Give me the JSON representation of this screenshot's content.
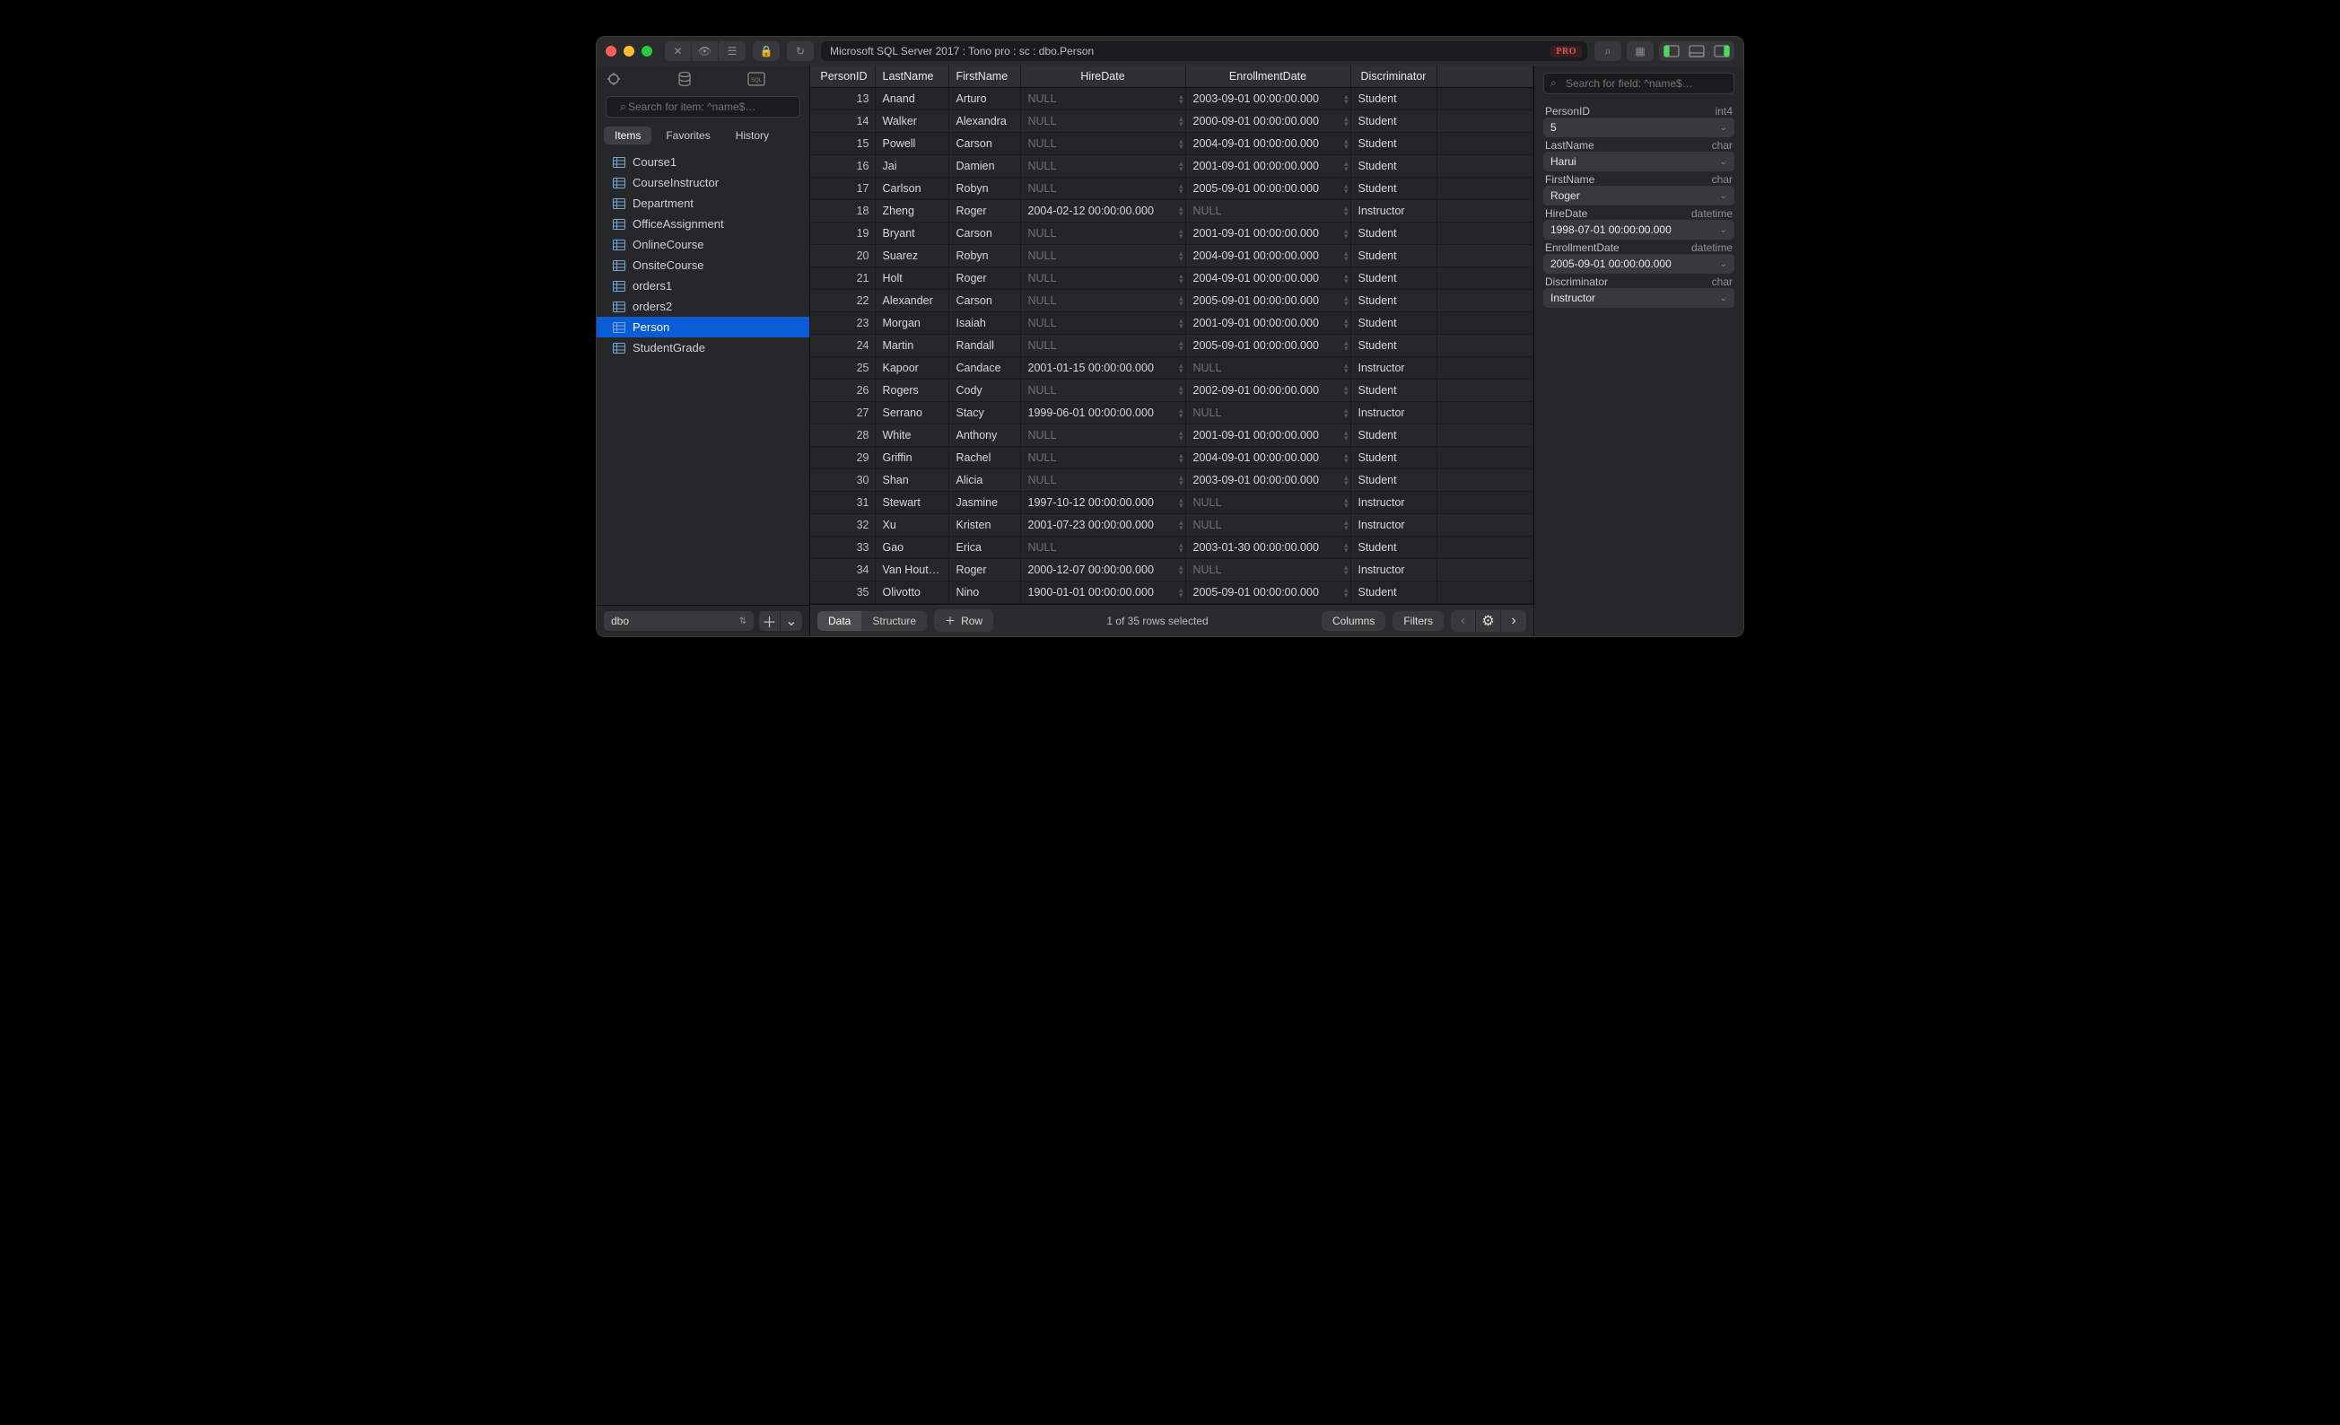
{
  "titlebar": {
    "breadcrumb": "Microsoft SQL Server 2017 : Tono pro : sc : dbo.Person",
    "pro_badge": "PRO"
  },
  "sidebar": {
    "search_placeholder": "Search for item: ^name$…",
    "tabs": [
      "Items",
      "Favorites",
      "History"
    ],
    "active_tab": 0,
    "items": [
      "Course1",
      "CourseInstructor",
      "Department",
      "OfficeAssignment",
      "OnlineCourse",
      "OnsiteCourse",
      "orders1",
      "orders2",
      "Person",
      "StudentGrade"
    ],
    "active_item": 8,
    "schema": "dbo"
  },
  "table": {
    "columns": [
      "PersonID",
      "LastName",
      "FirstName",
      "HireDate",
      "EnrollmentDate",
      "Discriminator"
    ],
    "rows": [
      {
        "id": "13",
        "last": "Anand",
        "first": "Arturo",
        "hire": null,
        "enroll": "2003-09-01 00:00:00.000",
        "disc": "Student"
      },
      {
        "id": "14",
        "last": "Walker",
        "first": "Alexandra",
        "hire": null,
        "enroll": "2000-09-01 00:00:00.000",
        "disc": "Student"
      },
      {
        "id": "15",
        "last": "Powell",
        "first": "Carson",
        "hire": null,
        "enroll": "2004-09-01 00:00:00.000",
        "disc": "Student"
      },
      {
        "id": "16",
        "last": "Jai",
        "first": "Damien",
        "hire": null,
        "enroll": "2001-09-01 00:00:00.000",
        "disc": "Student"
      },
      {
        "id": "17",
        "last": "Carlson",
        "first": "Robyn",
        "hire": null,
        "enroll": "2005-09-01 00:00:00.000",
        "disc": "Student"
      },
      {
        "id": "18",
        "last": "Zheng",
        "first": "Roger",
        "hire": "2004-02-12 00:00:00.000",
        "enroll": null,
        "disc": "Instructor"
      },
      {
        "id": "19",
        "last": "Bryant",
        "first": "Carson",
        "hire": null,
        "enroll": "2001-09-01 00:00:00.000",
        "disc": "Student"
      },
      {
        "id": "20",
        "last": "Suarez",
        "first": "Robyn",
        "hire": null,
        "enroll": "2004-09-01 00:00:00.000",
        "disc": "Student"
      },
      {
        "id": "21",
        "last": "Holt",
        "first": "Roger",
        "hire": null,
        "enroll": "2004-09-01 00:00:00.000",
        "disc": "Student"
      },
      {
        "id": "22",
        "last": "Alexander",
        "first": "Carson",
        "hire": null,
        "enroll": "2005-09-01 00:00:00.000",
        "disc": "Student"
      },
      {
        "id": "23",
        "last": "Morgan",
        "first": "Isaiah",
        "hire": null,
        "enroll": "2001-09-01 00:00:00.000",
        "disc": "Student"
      },
      {
        "id": "24",
        "last": "Martin",
        "first": "Randall",
        "hire": null,
        "enroll": "2005-09-01 00:00:00.000",
        "disc": "Student"
      },
      {
        "id": "25",
        "last": "Kapoor",
        "first": "Candace",
        "hire": "2001-01-15 00:00:00.000",
        "enroll": null,
        "disc": "Instructor"
      },
      {
        "id": "26",
        "last": "Rogers",
        "first": "Cody",
        "hire": null,
        "enroll": "2002-09-01 00:00:00.000",
        "disc": "Student"
      },
      {
        "id": "27",
        "last": "Serrano",
        "first": "Stacy",
        "hire": "1999-06-01 00:00:00.000",
        "enroll": null,
        "disc": "Instructor"
      },
      {
        "id": "28",
        "last": "White",
        "first": "Anthony",
        "hire": null,
        "enroll": "2001-09-01 00:00:00.000",
        "disc": "Student"
      },
      {
        "id": "29",
        "last": "Griffin",
        "first": "Rachel",
        "hire": null,
        "enroll": "2004-09-01 00:00:00.000",
        "disc": "Student"
      },
      {
        "id": "30",
        "last": "Shan",
        "first": "Alicia",
        "hire": null,
        "enroll": "2003-09-01 00:00:00.000",
        "disc": "Student"
      },
      {
        "id": "31",
        "last": "Stewart",
        "first": "Jasmine",
        "hire": "1997-10-12 00:00:00.000",
        "enroll": null,
        "disc": "Instructor"
      },
      {
        "id": "32",
        "last": "Xu",
        "first": "Kristen",
        "hire": "2001-07-23 00:00:00.000",
        "enroll": null,
        "disc": "Instructor"
      },
      {
        "id": "33",
        "last": "Gao",
        "first": "Erica",
        "hire": null,
        "enroll": "2003-01-30 00:00:00.000",
        "disc": "Student"
      },
      {
        "id": "34",
        "last": "Van Houten",
        "first": "Roger",
        "hire": "2000-12-07 00:00:00.000",
        "enroll": null,
        "disc": "Instructor"
      },
      {
        "id": "35",
        "last": "Olivotto",
        "first": "Nino",
        "hire": "1900-01-01 00:00:00.000",
        "enroll": "2005-09-01 00:00:00.000",
        "disc": "Student"
      }
    ],
    "null_label": "NULL"
  },
  "footer": {
    "data_label": "Data",
    "structure_label": "Structure",
    "row_label": "Row",
    "status": "1 of 35 rows selected",
    "columns_label": "Columns",
    "filters_label": "Filters"
  },
  "inspector": {
    "search_placeholder": "Search for field: ^name$…",
    "fields": [
      {
        "name": "PersonID",
        "type": "int4",
        "value": "5"
      },
      {
        "name": "LastName",
        "type": "char",
        "value": "Harui"
      },
      {
        "name": "FirstName",
        "type": "char",
        "value": "Roger"
      },
      {
        "name": "HireDate",
        "type": "datetime",
        "value": "1998-07-01 00:00:00.000"
      },
      {
        "name": "EnrollmentDate",
        "type": "datetime",
        "value": "2005-09-01 00:00:00.000"
      },
      {
        "name": "Discriminator",
        "type": "char",
        "value": "Instructor"
      }
    ]
  }
}
